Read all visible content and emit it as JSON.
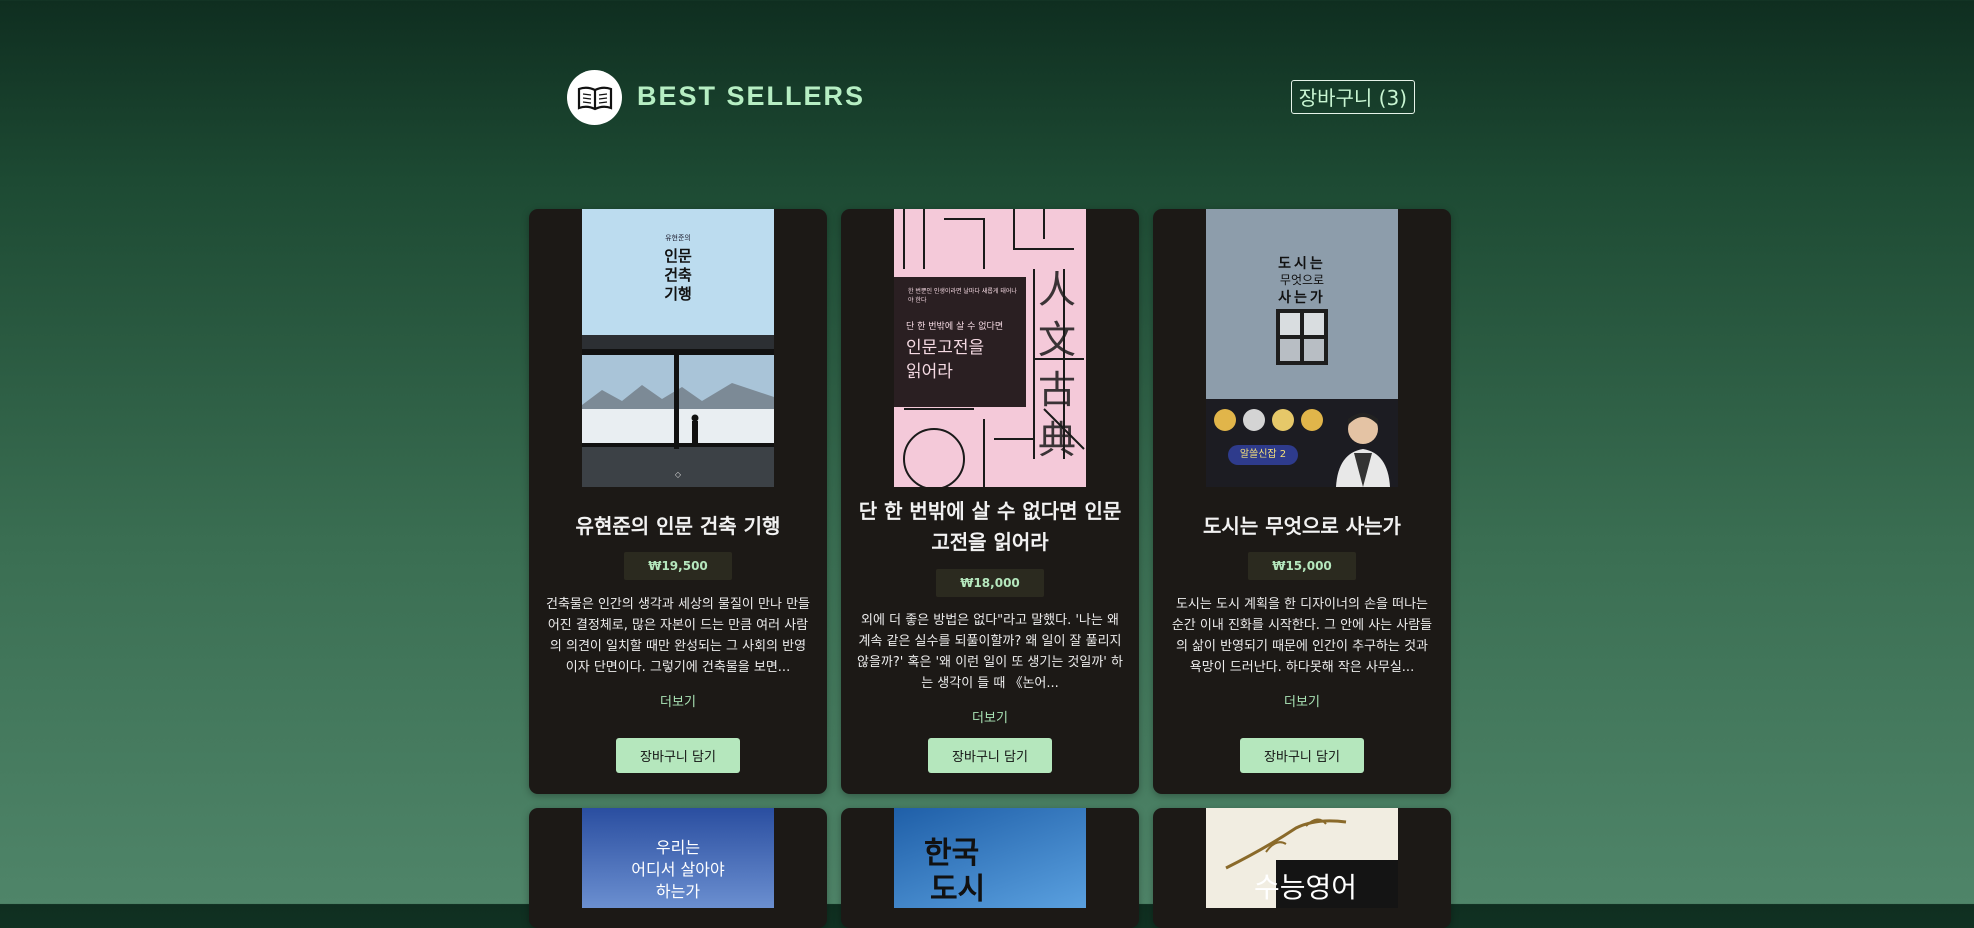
{
  "header": {
    "title": "BEST SELLERS",
    "cart_label": "장바구니 (3)",
    "logo_icon": "open-book-icon"
  },
  "books": [
    {
      "title": "유현준의 인문 건축 기행",
      "price": "₩19,500",
      "description": "건축물은 인간의 생각과 세상의 물질이 만나 만들어진 결정체로, 많은 자본이 드는 만큼 여러 사람의 의견이 일치할 때만 완성되는 그 사회의 반영이자 단면이다. 그렇기에 건축물을 보면...",
      "more_label": "더보기",
      "add_label": "장바구니 담기",
      "cover": {
        "author": "유현준의",
        "line1": "인문",
        "line2": "건축",
        "line3": "기행"
      }
    },
    {
      "title": "단 한 번밖에 살 수 없다면 인문고전을 읽어라",
      "price": "₩18,000",
      "description": "외에 더 좋은 방법은 없다\"라고 말했다. '나는 왜 계속 같은 실수를 되풀이할까? 왜 일이 잘 풀리지 않을까?' 혹은 '왜 이런 일이 또 생기는 것일까' 하는 생각이 들 때 《논어...",
      "more_label": "더보기",
      "add_label": "장바구니 담기",
      "cover": {
        "tagline": "한 번뿐인 인생이라면 날마다 새롭게 태어나야 한다",
        "sub": "단 한 번밖에 살 수 없다면",
        "line1": "인문고전을",
        "line2": "읽어라",
        "glyphs": "人文古典"
      }
    },
    {
      "title": "도시는 무엇으로 사는가",
      "price": "₩15,000",
      "description": "도시는 도시 계획을 한 디자이너의 손을 떠나는 순간 이내 진화를 시작한다. 그 안에 사는 사람들의 삶이 반영되기 때문에 인간이 추구하는 것과 욕망이 드러난다. 하다못해 작은 사무실...",
      "more_label": "더보기",
      "add_label": "장바구니 담기",
      "cover": {
        "line1": "도시는",
        "line2": "무엇으로",
        "line3": "사는가",
        "badge": "알쓸신잡 2"
      }
    }
  ],
  "second_row": [
    {
      "cover": {
        "line1": "우리는",
        "line2": "어디서 살아야",
        "line3": "하는가"
      }
    },
    {
      "cover": {
        "line1": "한국",
        "line2": "도시"
      }
    },
    {
      "cover": {
        "line1": "수능영어"
      }
    }
  ]
}
